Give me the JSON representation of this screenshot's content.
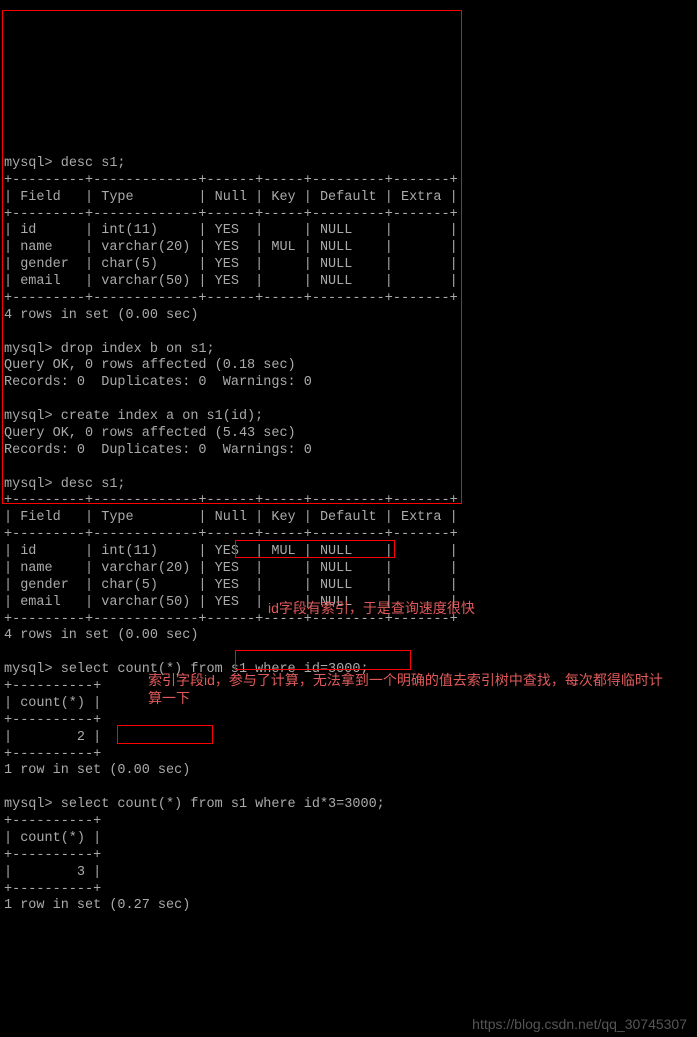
{
  "prompt": "mysql>",
  "cmd_desc1": "desc s1;",
  "tbl_border_top": "+---------+-------------+------+-----+---------+-------+",
  "tbl_header": "| Field   | Type        | Null | Key | Default | Extra |",
  "tbl1_rows": [
    "| id      | int(11)     | YES  |     | NULL    |       |",
    "| name    | varchar(20) | YES  | MUL | NULL    |       |",
    "| gender  | char(5)     | YES  |     | NULL    |       |",
    "| email   | varchar(50) | YES  |     | NULL    |       |"
  ],
  "rows_in_set4": "4 rows in set (0.00 sec)",
  "cmd_dropindex": "drop index b on s1;",
  "queryok_018": "Query OK, 0 rows affected (0.18 sec)",
  "records0": "Records: 0  Duplicates: 0  Warnings: 0",
  "cmd_createindex": "create index a on s1(id);",
  "queryok_543": "Query OK, 0 rows affected (5.43 sec)",
  "cmd_desc2": "desc s1;",
  "tbl2_rows": [
    "| id      | int(11)     | YES  | MUL | NULL    |       |",
    "| name    | varchar(20) | YES  |     | NULL    |       |",
    "| gender  | char(5)     | YES  |     | NULL    |       |",
    "| email   | varchar(50) | YES  |     | NULL    |       |"
  ],
  "cmd_select1": "select count(*) from s1 where id=3000;",
  "count_border": "+----------+",
  "count_header": "| count(*) |",
  "count_val1": "|        2 |",
  "row1_000": "1 row in set (0.00 sec)",
  "cmd_select2": "select count(*) from s1 where id*3=3000;",
  "count_val2": "|        3 |",
  "row1_027": "1 row in set (0.27 sec)",
  "annotation1": "id字段有索引，于是查询速度很快",
  "annotation2": "索引字段id，参与了计算，无法拿到一个明确的值去索引树中查找，每次都得临时计算一下",
  "watermark": "https://blog.csdn.net/qq_30745307"
}
